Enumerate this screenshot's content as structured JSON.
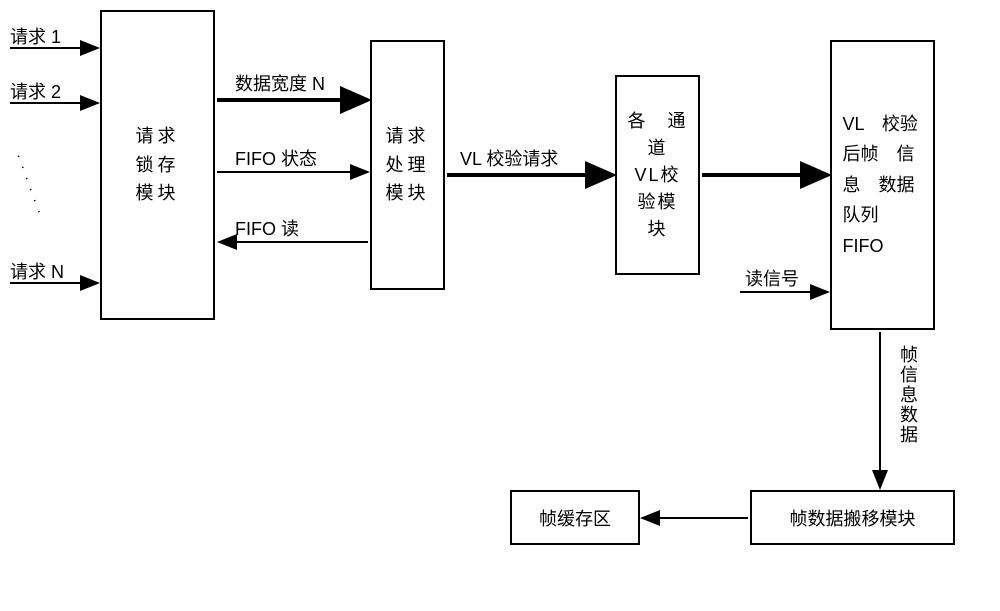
{
  "inputs": {
    "request1": "请求 1",
    "request2": "请求 2",
    "requestN": "请求 N"
  },
  "boxes": {
    "requestLatch": "请求锁存模块",
    "requestProcess": "请求处理模块",
    "vlCheck": "各通道 VL校验模块",
    "vlFifo": "VL 校验后帧信息数据队列FIFO",
    "frameMove": "帧数据搬移模块",
    "frameBuffer": "帧缓存区"
  },
  "arrows": {
    "dataWidth": "数据宽度 N",
    "fifoStatus": "FIFO 状态",
    "fifoRead": "FIFO 读",
    "vlCheckReq": "VL 校验请求",
    "readSignal": "读信号",
    "frameInfoData": "帧信息数据"
  }
}
